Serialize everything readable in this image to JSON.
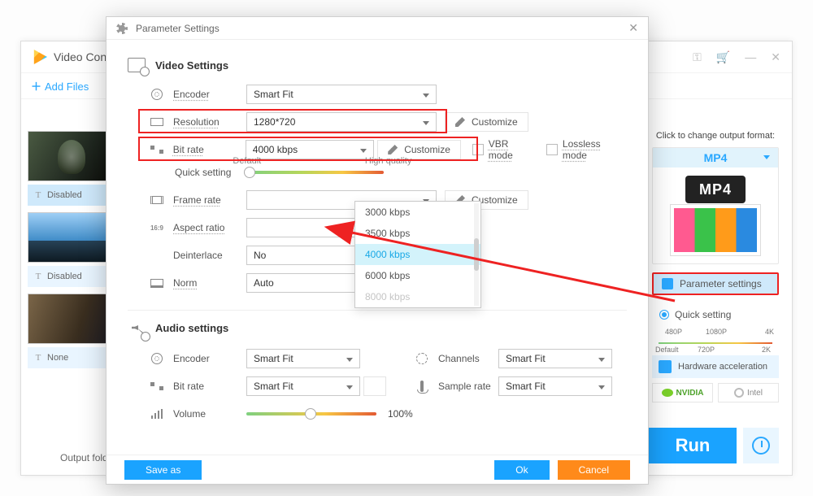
{
  "mainwin": {
    "title": "Video Conv",
    "add_files": "Add Files",
    "output_folder_label": "Output folder:",
    "thumb_captions": [
      "Disabled",
      "Disabled",
      "None"
    ],
    "win_icons": {
      "key": "⚿",
      "cart": "🛒",
      "min": "—",
      "close": "✕"
    }
  },
  "rpanel": {
    "change_label": "Click to change output format:",
    "format": "MP4",
    "param_label": "Parameter settings",
    "quick_label": "Quick setting",
    "slider_top": [
      "480P",
      "1080P",
      "4K"
    ],
    "slider_bot": [
      "Default",
      "720P",
      "2K"
    ],
    "hw_label": "Hardware acceleration",
    "gpu_nvidia": "NVIDIA",
    "gpu_intel": "Intel",
    "run": "Run"
  },
  "dialog": {
    "title": "Parameter Settings",
    "video_heading": "Video Settings",
    "audio_heading": "Audio settings",
    "video": {
      "encoder_label": "Encoder",
      "encoder_value": "Smart Fit",
      "resolution_label": "Resolution",
      "resolution_value": "1280*720",
      "customize": "Customize",
      "bitrate_label": "Bit rate",
      "bitrate_value": "4000 kbps",
      "vbr_label": "VBR mode",
      "lossless_label": "Lossless mode",
      "quick_label": "Quick setting",
      "quick_default": "Default",
      "quick_hq": "High quality",
      "framerate_label": "Frame rate",
      "aspect_label": "Aspect ratio",
      "deinterlace_label": "Deinterlace",
      "deinterlace_value": "No",
      "norm_label": "Norm",
      "norm_value": "Auto"
    },
    "bitrate_options": [
      "3000 kbps",
      "3500 kbps",
      "4000 kbps",
      "6000 kbps",
      "8000 kbps"
    ],
    "bitrate_selected_index": 2,
    "audio": {
      "encoder_label": "Encoder",
      "encoder_value": "Smart Fit",
      "bitrate_label": "Bit rate",
      "bitrate_value": "Smart Fit",
      "channels_label": "Channels",
      "channels_value": "Smart Fit",
      "samplerate_label": "Sample rate",
      "samplerate_value": "Smart Fit",
      "volume_label": "Volume",
      "volume_value": "100%"
    },
    "footer": {
      "save": "Save as",
      "ok": "Ok",
      "cancel": "Cancel"
    }
  }
}
